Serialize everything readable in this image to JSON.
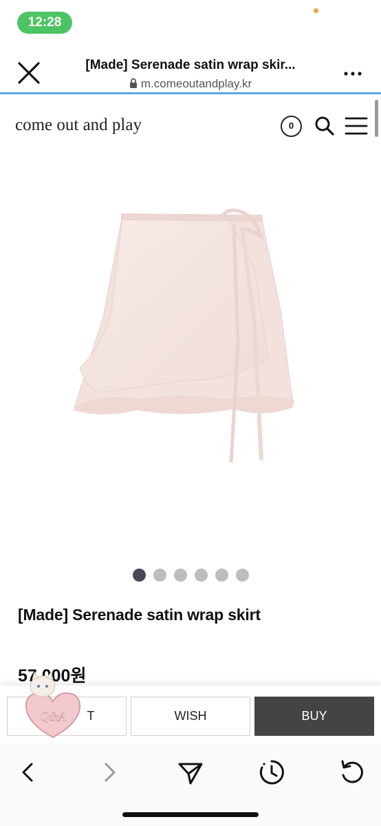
{
  "status_bar": {
    "time": "12:28",
    "pill_color": "#4cc463"
  },
  "browser": {
    "title": "[Made] Serenade satin wrap skir...",
    "url": "m.comeoutandplay.kr",
    "close_icon": "close-icon",
    "more_icon": "more-icon",
    "lock_icon": "lock-icon",
    "progress_color": "#5aa9e6"
  },
  "site": {
    "logo": "come out and play",
    "cart_count": "0",
    "search_icon": "search-icon",
    "menu_icon": "hamburger-menu-icon"
  },
  "product": {
    "image_icon": "wrap-skirt-image",
    "image_color": "#f4e4e1",
    "carousel": {
      "total": 6,
      "active_index": 0
    },
    "name": "[Made] Serenade satin wrap skirt",
    "price": "57,000원"
  },
  "actions": {
    "cart_label": "CART",
    "cart_label_visible": "T",
    "wish_label": "WISH",
    "buy_label": "BUY",
    "buy_color": "#444444"
  },
  "sticker": {
    "text": "Q&A"
  },
  "nav": {
    "back_icon": "chevron-left-icon",
    "forward_icon": "chevron-right-icon",
    "share_icon": "send-icon",
    "history_icon": "history-clock-icon",
    "reload_icon": "reload-icon"
  }
}
